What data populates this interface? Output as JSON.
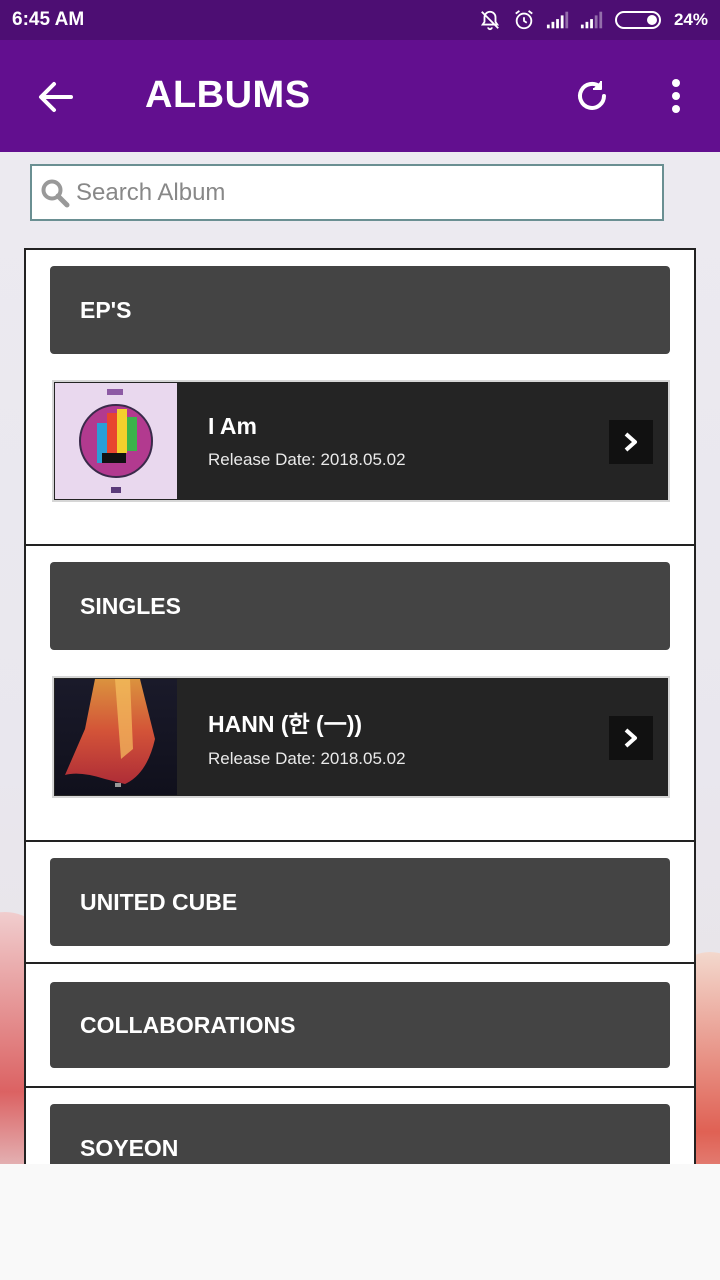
{
  "status_bar": {
    "time": "6:45 AM",
    "battery": "24%"
  },
  "app_bar": {
    "title": "ALBUMS"
  },
  "search": {
    "placeholder": "Search Album",
    "value": ""
  },
  "sections": [
    {
      "title": "EP'S",
      "albums": [
        {
          "title": "I Am",
          "release": "Release Date: 2018.05.02"
        }
      ]
    },
    {
      "title": "SINGLES",
      "albums": [
        {
          "title": "HANN (한 (一))",
          "release": "Release Date: 2018.05.02"
        }
      ]
    },
    {
      "title": "UNITED CUBE",
      "albums": []
    },
    {
      "title": "COLLABORATIONS",
      "albums": []
    },
    {
      "title": "SOYEON",
      "albums": []
    }
  ],
  "colors": {
    "status_bar": "#4d0e73",
    "app_bar": "#620f8f",
    "section_header": "#444444",
    "album_card": "#242424"
  },
  "icons": {
    "back": "arrow-left-icon",
    "refresh": "refresh-icon",
    "menu": "more-vert-icon",
    "search": "search-icon",
    "chevron": "chevron-right-icon"
  }
}
